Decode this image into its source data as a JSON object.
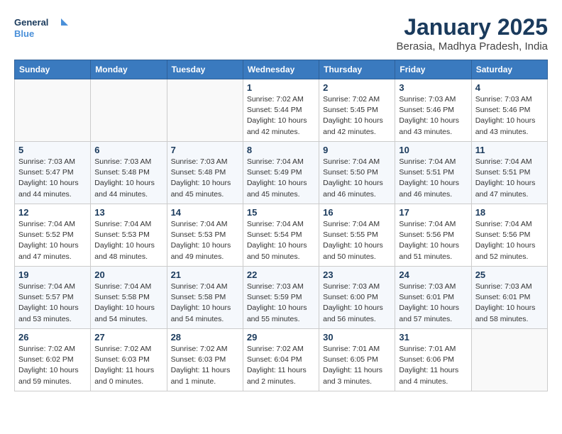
{
  "header": {
    "logo_line1": "General",
    "logo_line2": "Blue",
    "title": "January 2025",
    "subtitle": "Berasia, Madhya Pradesh, India"
  },
  "weekdays": [
    "Sunday",
    "Monday",
    "Tuesday",
    "Wednesday",
    "Thursday",
    "Friday",
    "Saturday"
  ],
  "weeks": [
    [
      {
        "day": "",
        "sunrise": "",
        "sunset": "",
        "daylight": ""
      },
      {
        "day": "",
        "sunrise": "",
        "sunset": "",
        "daylight": ""
      },
      {
        "day": "",
        "sunrise": "",
        "sunset": "",
        "daylight": ""
      },
      {
        "day": "1",
        "sunrise": "Sunrise: 7:02 AM",
        "sunset": "Sunset: 5:44 PM",
        "daylight": "Daylight: 10 hours and 42 minutes."
      },
      {
        "day": "2",
        "sunrise": "Sunrise: 7:02 AM",
        "sunset": "Sunset: 5:45 PM",
        "daylight": "Daylight: 10 hours and 42 minutes."
      },
      {
        "day": "3",
        "sunrise": "Sunrise: 7:03 AM",
        "sunset": "Sunset: 5:46 PM",
        "daylight": "Daylight: 10 hours and 43 minutes."
      },
      {
        "day": "4",
        "sunrise": "Sunrise: 7:03 AM",
        "sunset": "Sunset: 5:46 PM",
        "daylight": "Daylight: 10 hours and 43 minutes."
      }
    ],
    [
      {
        "day": "5",
        "sunrise": "Sunrise: 7:03 AM",
        "sunset": "Sunset: 5:47 PM",
        "daylight": "Daylight: 10 hours and 44 minutes."
      },
      {
        "day": "6",
        "sunrise": "Sunrise: 7:03 AM",
        "sunset": "Sunset: 5:48 PM",
        "daylight": "Daylight: 10 hours and 44 minutes."
      },
      {
        "day": "7",
        "sunrise": "Sunrise: 7:03 AM",
        "sunset": "Sunset: 5:48 PM",
        "daylight": "Daylight: 10 hours and 45 minutes."
      },
      {
        "day": "8",
        "sunrise": "Sunrise: 7:04 AM",
        "sunset": "Sunset: 5:49 PM",
        "daylight": "Daylight: 10 hours and 45 minutes."
      },
      {
        "day": "9",
        "sunrise": "Sunrise: 7:04 AM",
        "sunset": "Sunset: 5:50 PM",
        "daylight": "Daylight: 10 hours and 46 minutes."
      },
      {
        "day": "10",
        "sunrise": "Sunrise: 7:04 AM",
        "sunset": "Sunset: 5:51 PM",
        "daylight": "Daylight: 10 hours and 46 minutes."
      },
      {
        "day": "11",
        "sunrise": "Sunrise: 7:04 AM",
        "sunset": "Sunset: 5:51 PM",
        "daylight": "Daylight: 10 hours and 47 minutes."
      }
    ],
    [
      {
        "day": "12",
        "sunrise": "Sunrise: 7:04 AM",
        "sunset": "Sunset: 5:52 PM",
        "daylight": "Daylight: 10 hours and 47 minutes."
      },
      {
        "day": "13",
        "sunrise": "Sunrise: 7:04 AM",
        "sunset": "Sunset: 5:53 PM",
        "daylight": "Daylight: 10 hours and 48 minutes."
      },
      {
        "day": "14",
        "sunrise": "Sunrise: 7:04 AM",
        "sunset": "Sunset: 5:53 PM",
        "daylight": "Daylight: 10 hours and 49 minutes."
      },
      {
        "day": "15",
        "sunrise": "Sunrise: 7:04 AM",
        "sunset": "Sunset: 5:54 PM",
        "daylight": "Daylight: 10 hours and 50 minutes."
      },
      {
        "day": "16",
        "sunrise": "Sunrise: 7:04 AM",
        "sunset": "Sunset: 5:55 PM",
        "daylight": "Daylight: 10 hours and 50 minutes."
      },
      {
        "day": "17",
        "sunrise": "Sunrise: 7:04 AM",
        "sunset": "Sunset: 5:56 PM",
        "daylight": "Daylight: 10 hours and 51 minutes."
      },
      {
        "day": "18",
        "sunrise": "Sunrise: 7:04 AM",
        "sunset": "Sunset: 5:56 PM",
        "daylight": "Daylight: 10 hours and 52 minutes."
      }
    ],
    [
      {
        "day": "19",
        "sunrise": "Sunrise: 7:04 AM",
        "sunset": "Sunset: 5:57 PM",
        "daylight": "Daylight: 10 hours and 53 minutes."
      },
      {
        "day": "20",
        "sunrise": "Sunrise: 7:04 AM",
        "sunset": "Sunset: 5:58 PM",
        "daylight": "Daylight: 10 hours and 54 minutes."
      },
      {
        "day": "21",
        "sunrise": "Sunrise: 7:04 AM",
        "sunset": "Sunset: 5:58 PM",
        "daylight": "Daylight: 10 hours and 54 minutes."
      },
      {
        "day": "22",
        "sunrise": "Sunrise: 7:03 AM",
        "sunset": "Sunset: 5:59 PM",
        "daylight": "Daylight: 10 hours and 55 minutes."
      },
      {
        "day": "23",
        "sunrise": "Sunrise: 7:03 AM",
        "sunset": "Sunset: 6:00 PM",
        "daylight": "Daylight: 10 hours and 56 minutes."
      },
      {
        "day": "24",
        "sunrise": "Sunrise: 7:03 AM",
        "sunset": "Sunset: 6:01 PM",
        "daylight": "Daylight: 10 hours and 57 minutes."
      },
      {
        "day": "25",
        "sunrise": "Sunrise: 7:03 AM",
        "sunset": "Sunset: 6:01 PM",
        "daylight": "Daylight: 10 hours and 58 minutes."
      }
    ],
    [
      {
        "day": "26",
        "sunrise": "Sunrise: 7:02 AM",
        "sunset": "Sunset: 6:02 PM",
        "daylight": "Daylight: 10 hours and 59 minutes."
      },
      {
        "day": "27",
        "sunrise": "Sunrise: 7:02 AM",
        "sunset": "Sunset: 6:03 PM",
        "daylight": "Daylight: 11 hours and 0 minutes."
      },
      {
        "day": "28",
        "sunrise": "Sunrise: 7:02 AM",
        "sunset": "Sunset: 6:03 PM",
        "daylight": "Daylight: 11 hours and 1 minute."
      },
      {
        "day": "29",
        "sunrise": "Sunrise: 7:02 AM",
        "sunset": "Sunset: 6:04 PM",
        "daylight": "Daylight: 11 hours and 2 minutes."
      },
      {
        "day": "30",
        "sunrise": "Sunrise: 7:01 AM",
        "sunset": "Sunset: 6:05 PM",
        "daylight": "Daylight: 11 hours and 3 minutes."
      },
      {
        "day": "31",
        "sunrise": "Sunrise: 7:01 AM",
        "sunset": "Sunset: 6:06 PM",
        "daylight": "Daylight: 11 hours and 4 minutes."
      },
      {
        "day": "",
        "sunrise": "",
        "sunset": "",
        "daylight": ""
      }
    ]
  ]
}
